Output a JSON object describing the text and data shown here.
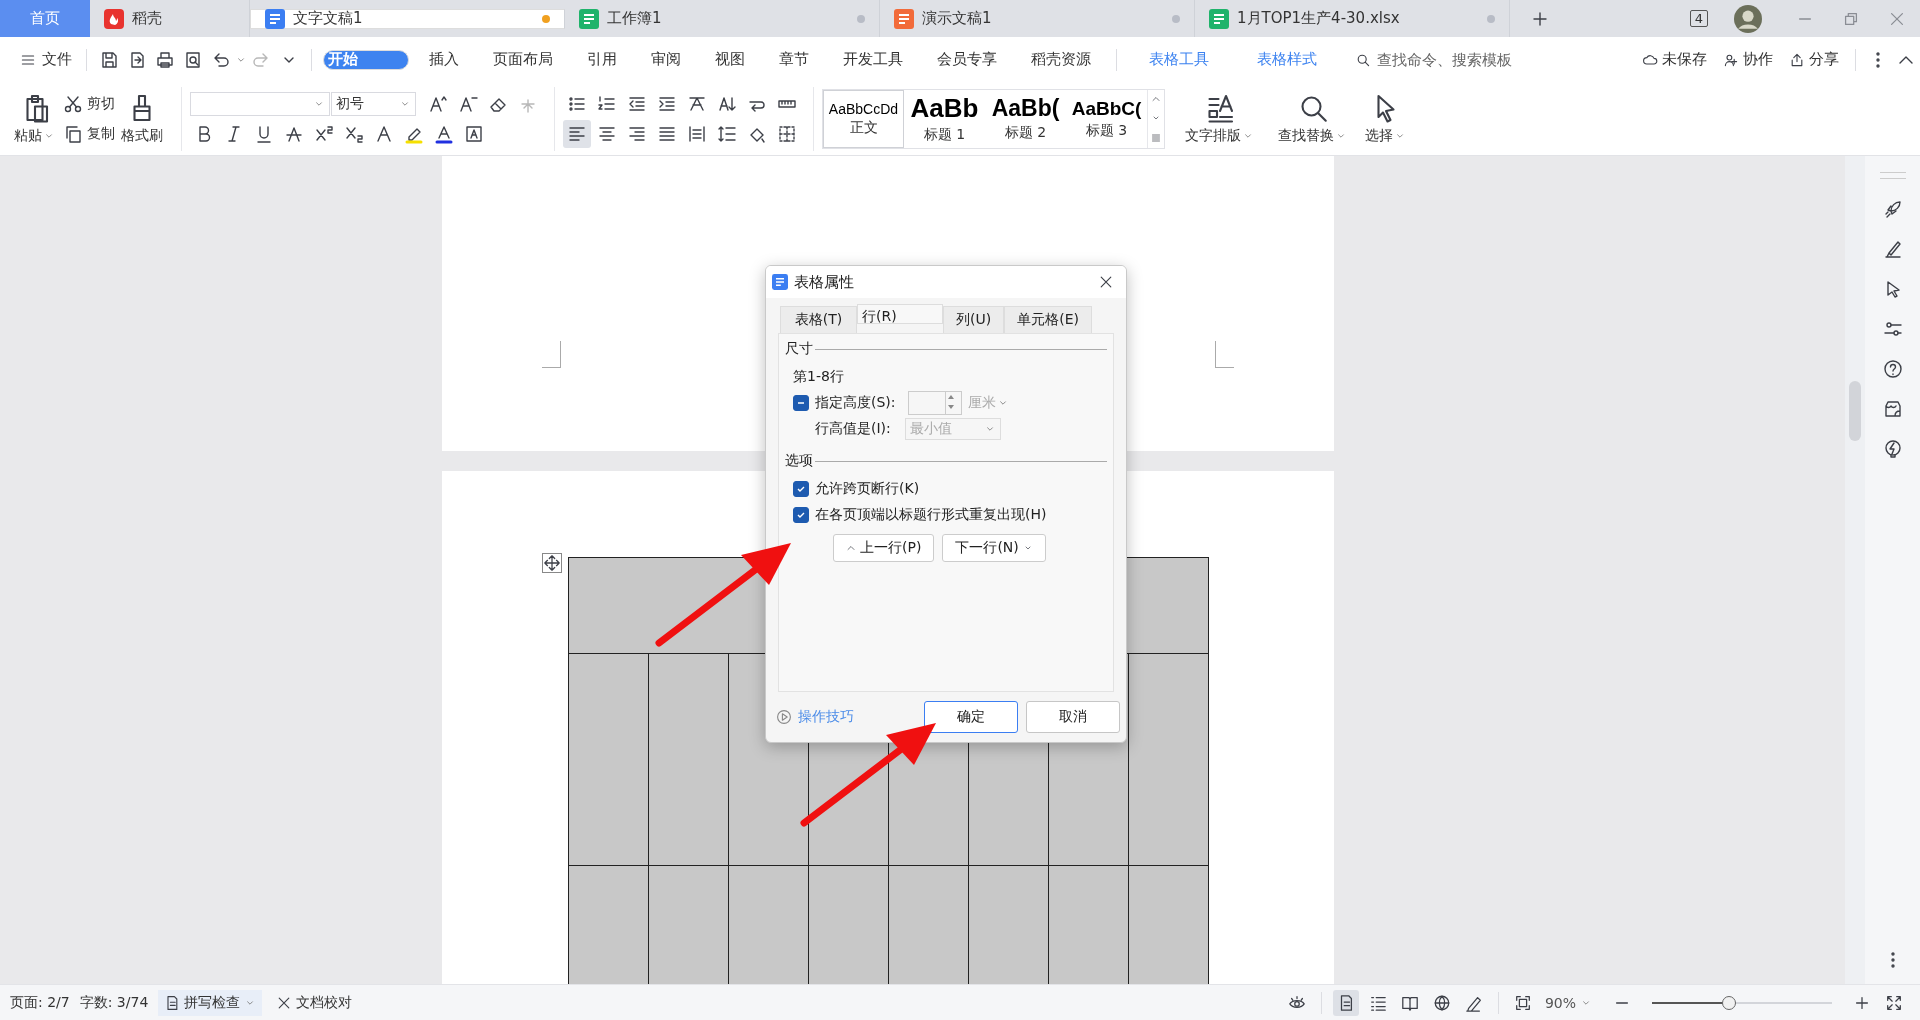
{
  "tabs": [
    {
      "label": "首页",
      "kind": "home",
      "selected": false
    },
    {
      "label": "稻壳",
      "kind": "docer",
      "selected": false
    },
    {
      "label": "文字文稿1",
      "kind": "writer",
      "selected": true,
      "color": "#f0a020"
    },
    {
      "label": "工作簿1",
      "kind": "sheet",
      "selected": false,
      "color": "#b8bcc6"
    },
    {
      "label": "演示文稿1",
      "kind": "slides",
      "selected": false,
      "color": "#b8bcc6"
    },
    {
      "label": "1月TOP1生产4-30.xlsx",
      "kind": "sheet",
      "selected": false,
      "color": "#b8bcc6"
    }
  ],
  "window_badge": "4",
  "menu": {
    "file": "文件",
    "items": [
      {
        "label": "开始",
        "selected": true,
        "contextual": false
      },
      {
        "label": "插入",
        "selected": false,
        "contextual": false
      },
      {
        "label": "页面布局",
        "selected": false,
        "contextual": false
      },
      {
        "label": "引用",
        "selected": false,
        "contextual": false
      },
      {
        "label": "审阅",
        "selected": false,
        "contextual": false
      },
      {
        "label": "视图",
        "selected": false,
        "contextual": false
      },
      {
        "label": "章节",
        "selected": false,
        "contextual": false
      },
      {
        "label": "开发工具",
        "selected": false,
        "contextual": false
      },
      {
        "label": "会员专享",
        "selected": false,
        "contextual": false
      },
      {
        "label": "稻壳资源",
        "selected": false,
        "contextual": false
      },
      {
        "label": "表格工具",
        "selected": false,
        "contextual": true
      },
      {
        "label": "表格样式",
        "selected": false,
        "contextual": true
      }
    ],
    "search_placeholder": "查找命令、搜索模板",
    "save_state": "未保存",
    "collaborate": "协作",
    "share": "分享"
  },
  "ribbon": {
    "paste": "粘贴",
    "cut": "剪切",
    "copy": "复制",
    "format_painter": "格式刷",
    "font_size": "初号",
    "styles": [
      {
        "preview": "AaBbCcDd",
        "name": "正文",
        "kind": "body",
        "selected": true
      },
      {
        "preview": "AaBb",
        "name": "标题 1",
        "kind": "h1",
        "selected": false
      },
      {
        "preview": "AaBb(",
        "name": "标题 2",
        "kind": "h2",
        "selected": false
      },
      {
        "preview": "AaBbC(",
        "name": "标题 3",
        "kind": "h3",
        "selected": false
      }
    ],
    "text_layout": "文字排版",
    "find_replace": "查找替换",
    "select": "选择"
  },
  "document": {
    "table_rows": [
      {
        "kind": "merged"
      },
      {
        "kind": "split"
      },
      {
        "kind": "split"
      }
    ]
  },
  "dialog": {
    "title": "表格属性",
    "tabs": [
      {
        "label": "表格(T)",
        "selected": false
      },
      {
        "label": "行(R)",
        "selected": true
      },
      {
        "label": "列(U)",
        "selected": false
      },
      {
        "label": "单元格(E)",
        "selected": false
      }
    ],
    "size_section": "尺寸",
    "rows_label": "第1-8行",
    "height": {
      "label": "指定高度(S):",
      "indeterminate": true,
      "unit": "厘米",
      "disabled": true
    },
    "height_rule": {
      "label": "行高值是(I):",
      "value": "最小值",
      "disabled": true
    },
    "options_section": "选项",
    "options": [
      {
        "label": "允许跨页断行(K)",
        "checked": true
      },
      {
        "label": "在各页顶端以标题行形式重复出现(H)",
        "checked": true
      }
    ],
    "prev_row": "上一行(P)",
    "next_row": "下一行(N)",
    "tips": "操作技巧",
    "ok": "确定",
    "cancel": "取消"
  },
  "status_bar": {
    "page": "页面: 2/7",
    "words": "字数: 3/74",
    "spell_check": "拼写检查",
    "proofread": "文档校对",
    "zoom": "90%",
    "zoom_slider": {
      "level": 0.43
    }
  }
}
